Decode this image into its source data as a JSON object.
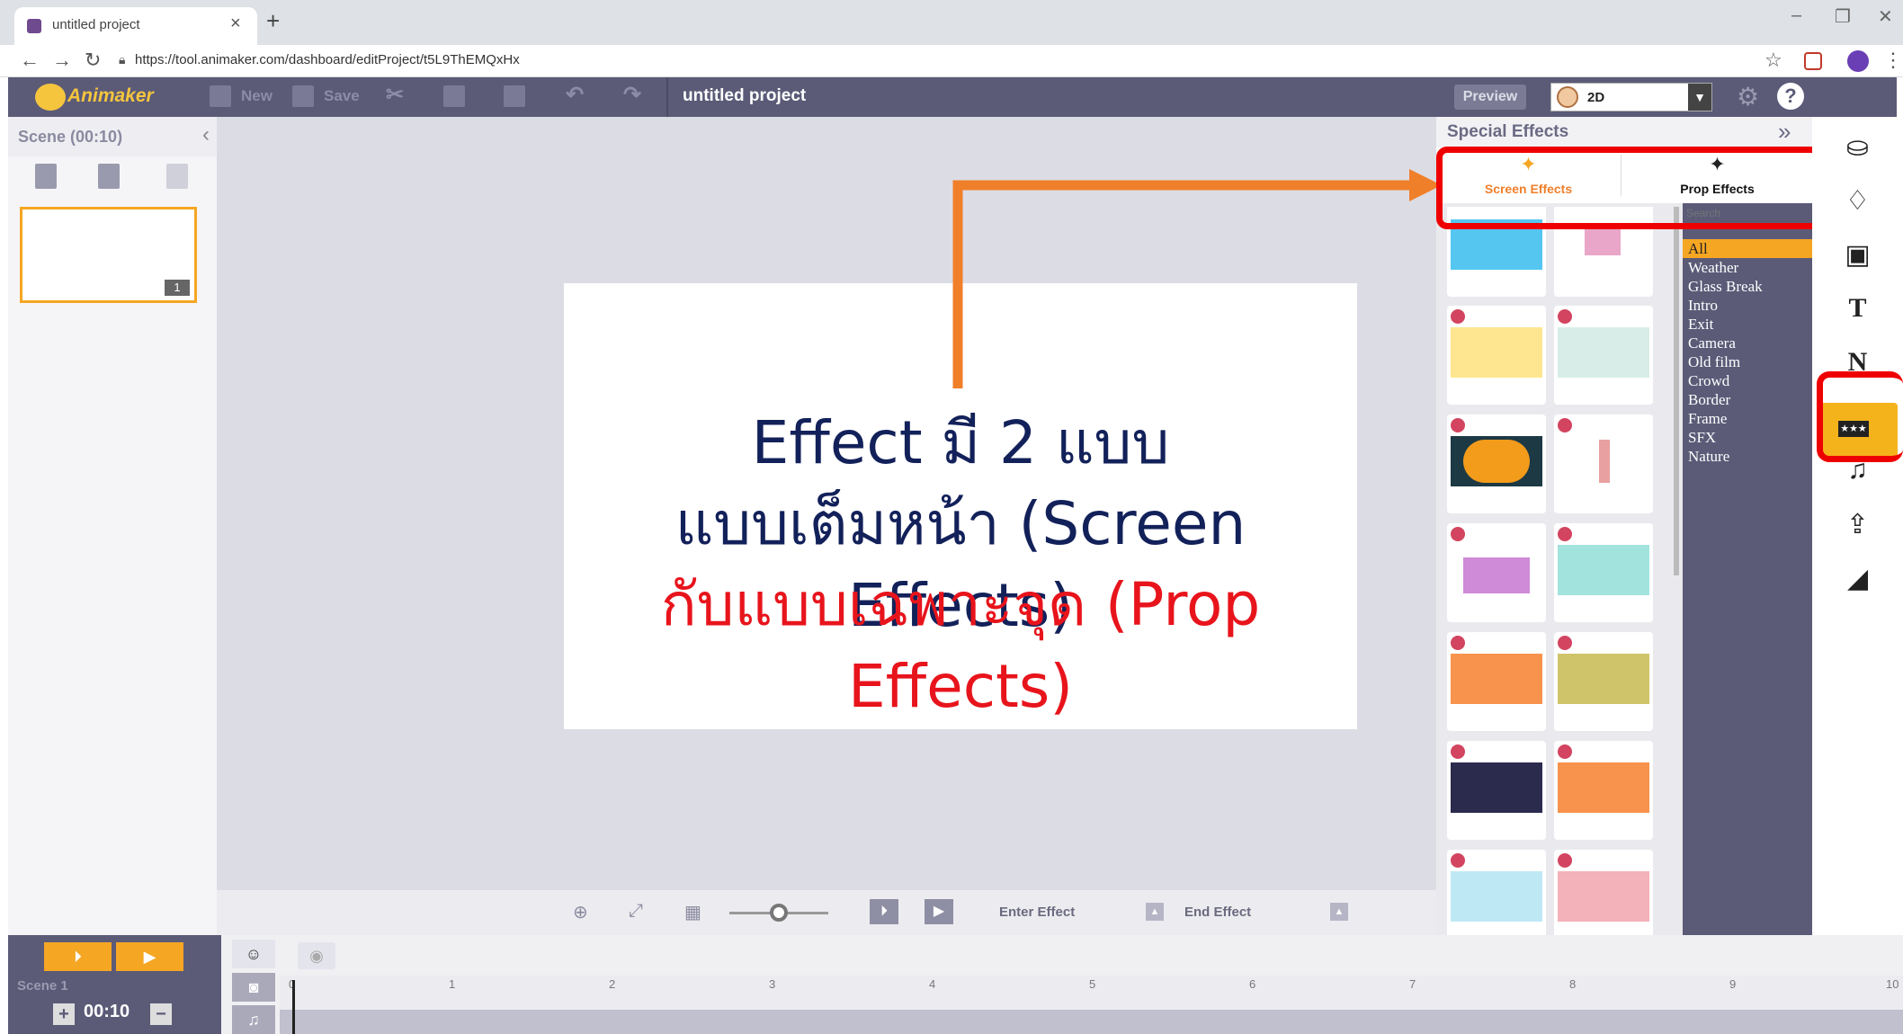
{
  "browser": {
    "tab_title": "untitled project",
    "url": "https://tool.animaker.com/dashboard/editProject/t5L9ThEMQxHx"
  },
  "toolbar": {
    "logo": "Animaker",
    "new_label": "New",
    "save_label": "Save",
    "project_title": "untitled project",
    "preview_label": "Preview",
    "mode_value": "2D"
  },
  "scene_panel": {
    "header": "Scene  (00:10)",
    "thumb_number": "1"
  },
  "stage": {
    "line1": "Effect มี 2 แบบ",
    "line2": "แบบเต็มหน้า (Screen Effects)",
    "line3": "กับแบบเฉพาะจุด (Prop Effects)"
  },
  "controls": {
    "enter_effect": "Enter Effect",
    "end_effect": "End Effect"
  },
  "effects_panel": {
    "title": "Special Effects",
    "tabs": [
      {
        "label": "Screen Effects",
        "icon": "magic-wand-icon",
        "active": true
      },
      {
        "label": "Prop Effects",
        "icon": "magic-wand-icon",
        "active": false
      }
    ],
    "search_placeholder": "Search",
    "categories": [
      "All",
      "Weather",
      "Glass Break",
      "Intro",
      "Exit",
      "Camera",
      "Old film",
      "Crowd",
      "Border",
      "Frame",
      "SFX",
      "Nature"
    ],
    "selected_category": "All"
  },
  "timeline": {
    "scene_label": "Scene 1",
    "duration": "00:10",
    "ticks": [
      "0",
      "1",
      "2",
      "3",
      "4",
      "5",
      "6",
      "7",
      "8",
      "9",
      "10"
    ]
  },
  "colors": {
    "accent": "#f5a623",
    "toolbar": "#5b5b78",
    "annotation_red": "#ef0000",
    "annotation_arrow": "#f07f2a",
    "title_navy": "#13215a"
  }
}
